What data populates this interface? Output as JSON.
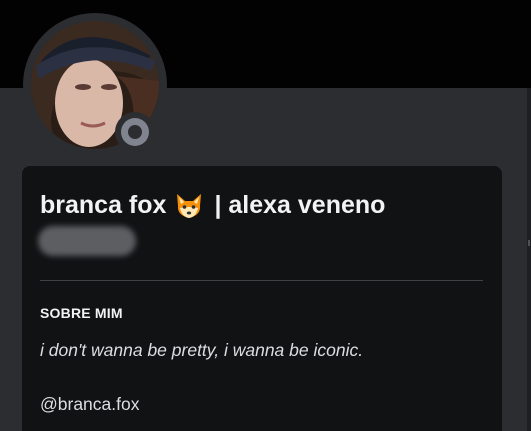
{
  "profile": {
    "display_name": "branca fox",
    "name_emoji": "fox-face-emoji",
    "name_suffix": "| alexa veneno",
    "status": "offline",
    "status_color": "#80848e",
    "about_title": "SOBRE MIM",
    "about_text": "i don't wanna be pretty, i wanna be iconic.",
    "handle": "@branca.fox"
  },
  "colors": {
    "banner": "#020202",
    "background": "#2b2d31",
    "card": "#111214",
    "text": "#f2f3f5"
  }
}
